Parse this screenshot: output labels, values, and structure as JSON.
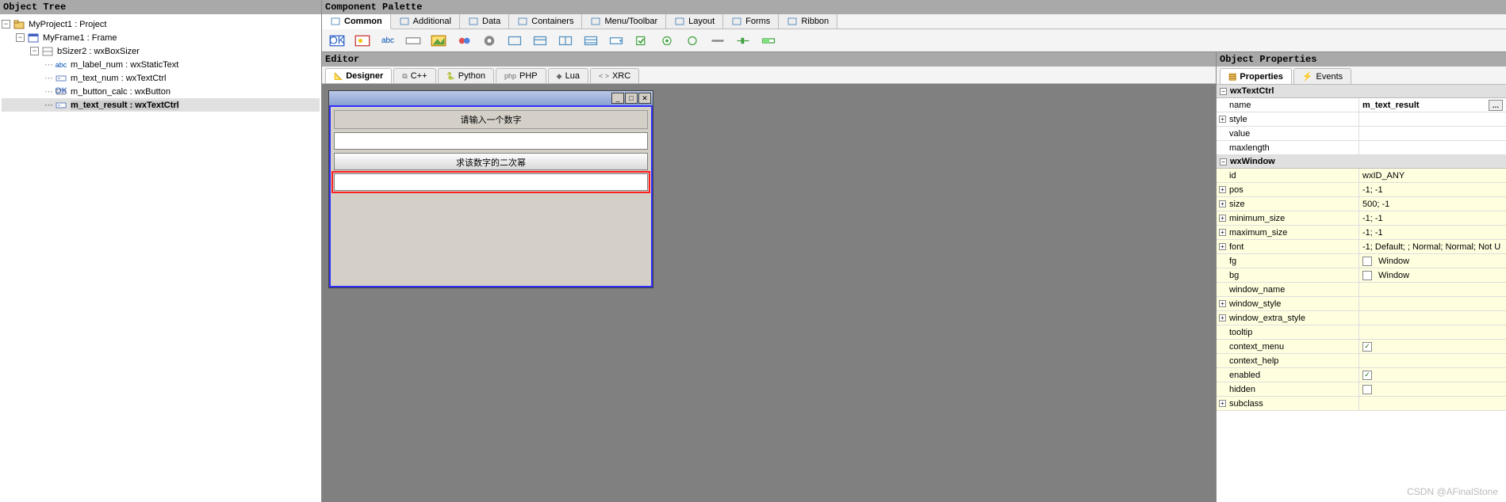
{
  "panels": {
    "object_tree": "Object Tree",
    "component_palette": "Component Palette",
    "editor": "Editor",
    "object_properties": "Object Properties"
  },
  "tree": {
    "items": [
      {
        "indent": 0,
        "exp": "-",
        "icon": "project",
        "label": "MyProject1 : Project"
      },
      {
        "indent": 1,
        "exp": "-",
        "icon": "frame",
        "label": "MyFrame1 : Frame"
      },
      {
        "indent": 2,
        "exp": "-",
        "icon": "sizer",
        "label": "bSizer2 : wxBoxSizer"
      },
      {
        "indent": 3,
        "exp": "",
        "icon": "abc",
        "label": "m_label_num : wxStaticText"
      },
      {
        "indent": 3,
        "exp": "",
        "icon": "text",
        "label": "m_text_num : wxTextCtrl"
      },
      {
        "indent": 3,
        "exp": "",
        "icon": "button",
        "label": "m_button_calc : wxButton"
      },
      {
        "indent": 3,
        "exp": "",
        "icon": "text",
        "label": "m_text_result : wxTextCtrl",
        "selected": true
      }
    ]
  },
  "palette": {
    "tabs": [
      "Common",
      "Additional",
      "Data",
      "Containers",
      "Menu/Toolbar",
      "Layout",
      "Forms",
      "Ribbon"
    ],
    "active_tab": 0
  },
  "editor": {
    "tabs": [
      "Designer",
      "C++",
      "Python",
      "PHP",
      "Lua",
      "XRC"
    ],
    "active_tab": 0,
    "form": {
      "label_text": "请输入一个数字",
      "button_text": "求该数字的二次幂"
    }
  },
  "properties": {
    "tabs": [
      "Properties",
      "Events"
    ],
    "active_tab": 0,
    "sections": [
      {
        "title": "wxTextCtrl",
        "yellow": false,
        "rows": [
          {
            "exp": "",
            "key": "name",
            "value": "m_text_result",
            "bold": true,
            "dots": true
          },
          {
            "exp": "+",
            "key": "style",
            "value": ""
          },
          {
            "exp": "",
            "key": "value",
            "value": ""
          },
          {
            "exp": "",
            "key": "maxlength",
            "value": ""
          }
        ]
      },
      {
        "title": "wxWindow",
        "yellow": true,
        "rows": [
          {
            "exp": "",
            "key": "id",
            "value": "wxID_ANY"
          },
          {
            "exp": "+",
            "key": "pos",
            "value": "-1; -1"
          },
          {
            "exp": "+",
            "key": "size",
            "value": "500; -1"
          },
          {
            "exp": "+",
            "key": "minimum_size",
            "value": "-1; -1"
          },
          {
            "exp": "+",
            "key": "maximum_size",
            "value": "-1; -1"
          },
          {
            "exp": "+",
            "key": "font",
            "value": "-1; Default; ; Normal; Normal; Not U"
          },
          {
            "exp": "",
            "key": "fg",
            "value": "Window",
            "swatch": true
          },
          {
            "exp": "",
            "key": "bg",
            "value": "Window",
            "swatch": true
          },
          {
            "exp": "",
            "key": "window_name",
            "value": ""
          },
          {
            "exp": "+",
            "key": "window_style",
            "value": ""
          },
          {
            "exp": "+",
            "key": "window_extra_style",
            "value": ""
          },
          {
            "exp": "",
            "key": "tooltip",
            "value": ""
          },
          {
            "exp": "",
            "key": "context_menu",
            "value": "",
            "check": true
          },
          {
            "exp": "",
            "key": "context_help",
            "value": ""
          },
          {
            "exp": "",
            "key": "enabled",
            "value": "",
            "check": true
          },
          {
            "exp": "",
            "key": "hidden",
            "value": "",
            "check": false
          },
          {
            "exp": "+",
            "key": "subclass",
            "value": ""
          }
        ]
      }
    ]
  },
  "watermark": "CSDN @AFinalStone"
}
